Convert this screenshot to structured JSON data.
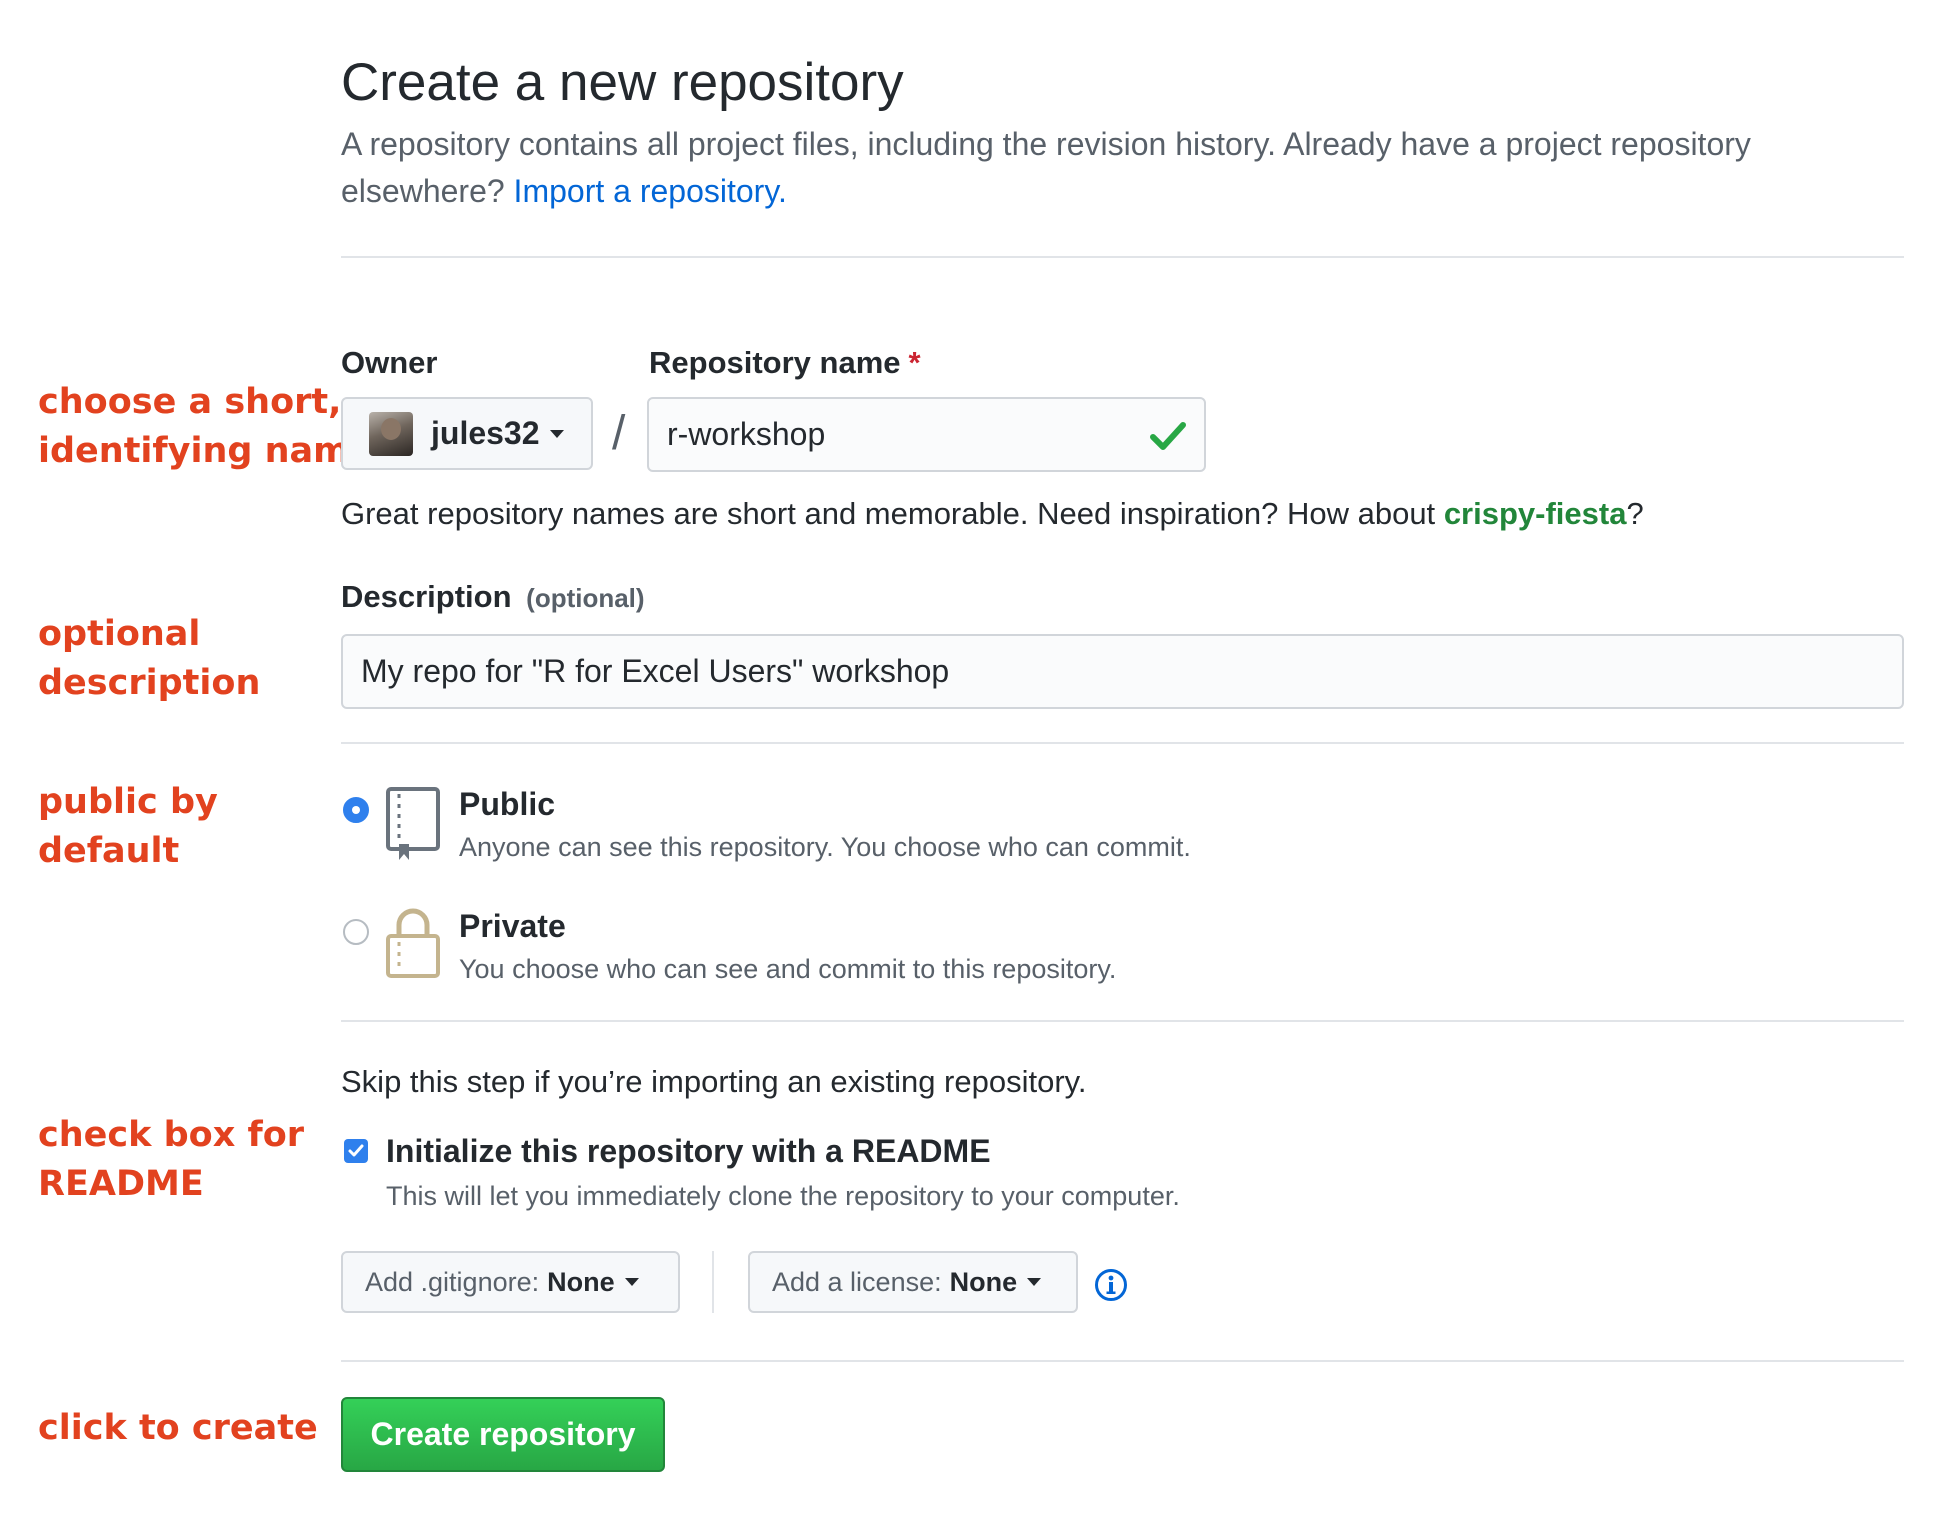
{
  "header": {
    "title": "Create a new repository",
    "subtitle": "A repository contains all project files, including the revision history. Already have a project repository elsewhere?",
    "import_link": "Import a repository."
  },
  "annotations": {
    "name": [
      "choose a short,",
      "identifying name"
    ],
    "description": [
      "optional",
      "description"
    ],
    "visibility": [
      "public by",
      "default"
    ],
    "readme": [
      "check box for",
      "README"
    ],
    "create": "click to create"
  },
  "owner": {
    "label": "Owner",
    "value": "jules32"
  },
  "repo_name": {
    "label": "Repository name",
    "required_mark": "*",
    "value": "r-workshop",
    "hint_prefix": "Great repository names are short and memorable. Need inspiration? How about",
    "suggestion": "crispy-fiesta",
    "hint_suffix": "?"
  },
  "description": {
    "label": "Description",
    "optional_tag": "(optional)",
    "value": "My repo for \"R for Excel Users\" workshop"
  },
  "visibility": {
    "selected": "public",
    "public": {
      "title": "Public",
      "desc": "Anyone can see this repository. You choose who can commit."
    },
    "private": {
      "title": "Private",
      "desc": "You choose who can see and commit to this repository."
    }
  },
  "init": {
    "skip_text": "Skip this step if you’re importing an existing repository.",
    "readme_checked": true,
    "readme_title": "Initialize this repository with a README",
    "readme_desc": "This will let you immediately clone the repository to your computer."
  },
  "gitignore": {
    "label": "Add .gitignore:",
    "value": "None"
  },
  "license": {
    "label": "Add a license:",
    "value": "None"
  },
  "create_button": "Create repository",
  "colors": {
    "annotation": "#e2421f",
    "link": "#0366d6",
    "suggestion": "#22863a",
    "primary_button": "#2ea44f",
    "radio_selected": "#2f80ed"
  }
}
